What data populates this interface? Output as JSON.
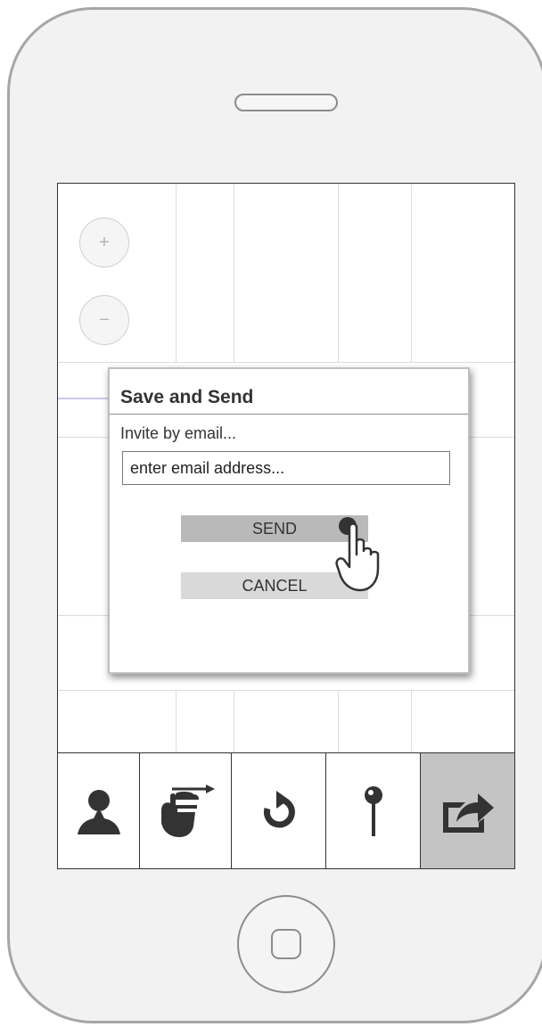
{
  "map": {
    "zoom_in_label": "+",
    "zoom_out_label": "−"
  },
  "dialog": {
    "title": "Save and Send",
    "subtitle": "Invite by email...",
    "email_placeholder": "enter email address...",
    "send_label": "SEND",
    "cancel_label": "CANCEL"
  },
  "toolbar": {
    "items": [
      {
        "icon": "user-icon",
        "active": false
      },
      {
        "icon": "swipe-hand-icon",
        "active": false
      },
      {
        "icon": "undo-icon",
        "active": false
      },
      {
        "icon": "pin-icon",
        "active": false
      },
      {
        "icon": "share-icon",
        "active": true
      }
    ]
  },
  "colors": {
    "frame": "#a6a6a6",
    "phone_body": "#f2f2f2",
    "active_tool": "#c4c4c4",
    "icon": "#333333",
    "route": "#c7c9ea"
  }
}
